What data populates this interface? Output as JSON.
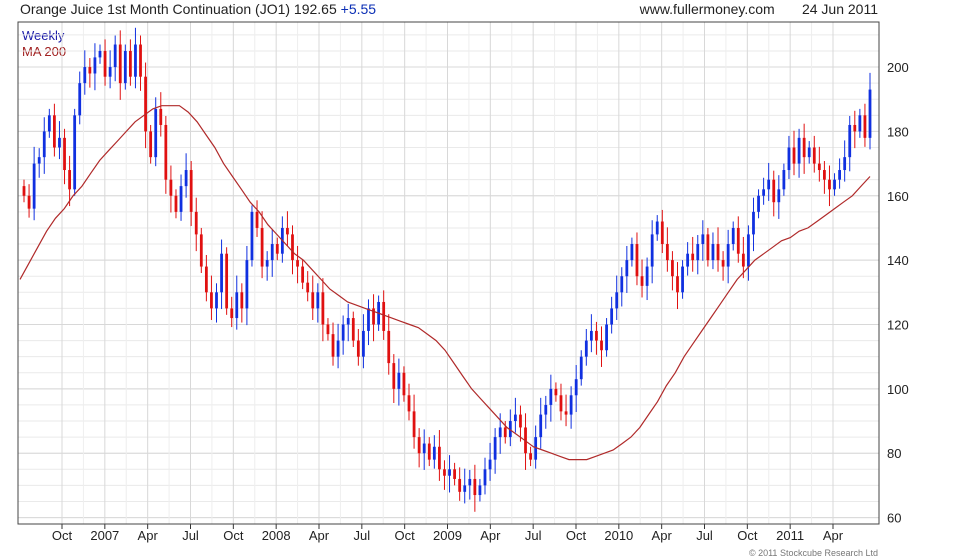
{
  "header": {
    "title": "Orange Juice 1st Month Continuation (JO1)",
    "last": "192.65",
    "change": "+5.55",
    "site": "www.fullermoney.com",
    "date": "24 Jun 2011"
  },
  "legend": {
    "weekly": "Weekly",
    "ma": "MA 200"
  },
  "copyright": "© 2011 Stockcube Research Ltd",
  "chart_data": {
    "type": "candlestick",
    "title": "Orange Juice 1st Month Continuation (JO1)",
    "ylim": [
      58,
      214
    ],
    "yticks": [
      60,
      80,
      100,
      120,
      140,
      160,
      180,
      200
    ],
    "xlabels": [
      "Oct",
      "2007",
      "Apr",
      "Jul",
      "Oct",
      "2008",
      "Apr",
      "Jul",
      "Oct",
      "2009",
      "Apr",
      "Jul",
      "Oct",
      "2010",
      "Apr",
      "Jul",
      "Oct",
      "2011",
      "Apr"
    ],
    "grid": true,
    "colors": {
      "up": "#1030e0",
      "down": "#e01010",
      "ma": "#b02a2a",
      "grid": "#d8d8d8"
    },
    "series": [
      {
        "name": "Weekly",
        "close": [
          160,
          156,
          170,
          172,
          180,
          185,
          175,
          178,
          168,
          162,
          185,
          195,
          200,
          198,
          203,
          205,
          197,
          200,
          207,
          195,
          205,
          197,
          207,
          197,
          180,
          172,
          187,
          182,
          165,
          160,
          155,
          163,
          168,
          155,
          148,
          138,
          130,
          125,
          130,
          142,
          125,
          122,
          130,
          125,
          140,
          155,
          150,
          138,
          140,
          145,
          142,
          150,
          148,
          140,
          138,
          133,
          130,
          125,
          130,
          120,
          117,
          110,
          115,
          120,
          122,
          115,
          110,
          118,
          125,
          120,
          127,
          118,
          108,
          100,
          105,
          98,
          93,
          85,
          80,
          83,
          78,
          82,
          75,
          73,
          75,
          72,
          68,
          70,
          72,
          67,
          70,
          75,
          78,
          85,
          88,
          85,
          90,
          92,
          88,
          80,
          78,
          85,
          92,
          95,
          100,
          98,
          93,
          92,
          98,
          103,
          110,
          115,
          118,
          115,
          112,
          120,
          125,
          130,
          135,
          140,
          145,
          135,
          132,
          138,
          148,
          152,
          145,
          140,
          135,
          130,
          138,
          142,
          140,
          145,
          148,
          140,
          145,
          140,
          138,
          145,
          150,
          142,
          138,
          148,
          155,
          160,
          162,
          165,
          158,
          162,
          168,
          175,
          170,
          178,
          172,
          175,
          170,
          168,
          165,
          162,
          165,
          168,
          172,
          182,
          180,
          185,
          178,
          193
        ]
      },
      {
        "name": "MA 200",
        "values": [
          134,
          139,
          144,
          149,
          153,
          156,
          160,
          163,
          167,
          171,
          174,
          177,
          180,
          183,
          185,
          187,
          188,
          188,
          188,
          186,
          183,
          179,
          175,
          170,
          166,
          162,
          158,
          155,
          151,
          148,
          145,
          142,
          140,
          137,
          134,
          131,
          129,
          127,
          126,
          125,
          124,
          123,
          122,
          121,
          120,
          119,
          117,
          115,
          112,
          108,
          104,
          100,
          97,
          94,
          91,
          88,
          86,
          84,
          82,
          81,
          80,
          79,
          78,
          78,
          78,
          79,
          80,
          81,
          83,
          85,
          88,
          92,
          96,
          101,
          105,
          110,
          114,
          118,
          122,
          126,
          130,
          134,
          137,
          140,
          142,
          144,
          146,
          147,
          149,
          150,
          152,
          154,
          156,
          158,
          160,
          163,
          166
        ]
      }
    ]
  }
}
